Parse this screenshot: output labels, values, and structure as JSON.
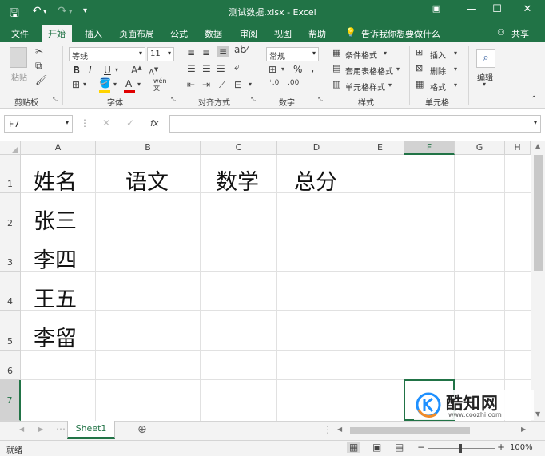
{
  "window": {
    "title": "测试数据.xlsx  -  Excel",
    "controls": [
      "restore-ribbon-icon",
      "minimize-icon",
      "maximize-icon",
      "close-icon"
    ]
  },
  "quick_access": [
    "save-icon",
    "undo-icon",
    "redo-icon",
    "customize-icon"
  ],
  "menu": {
    "tabs": [
      "文件",
      "开始",
      "插入",
      "页面布局",
      "公式",
      "数据",
      "审阅",
      "视图",
      "帮助"
    ],
    "active": "开始",
    "tell_me": "告诉我你想要做什么",
    "share": "共享"
  },
  "ribbon": {
    "clipboard": {
      "paste": "粘贴",
      "group": "剪贴板"
    },
    "font": {
      "name": "等线",
      "size": "11",
      "group": "字体",
      "bold": "B",
      "italic": "I",
      "underline": "U",
      "font_color_letter": "A",
      "wen": "wén\n文"
    },
    "alignment": {
      "group": "对齐方式"
    },
    "number": {
      "format": "常规",
      "percent": "%",
      "comma": ",",
      "group": "数字"
    },
    "styles": {
      "conditional": "条件格式",
      "table": "套用表格格式",
      "cell_styles": "单元格样式",
      "group": "样式"
    },
    "cells": {
      "insert": "插入",
      "delete": "删除",
      "format": "格式",
      "group": "单元格"
    },
    "editing": {
      "label": "编辑"
    }
  },
  "formula_bar": {
    "name_box": "F7",
    "fx": "fx",
    "content": ""
  },
  "columns": [
    "A",
    "B",
    "C",
    "D",
    "E",
    "F",
    "G",
    "H"
  ],
  "rows": [
    "1",
    "2",
    "3",
    "4",
    "5",
    "6",
    "7"
  ],
  "cells": {
    "A1": "姓名",
    "B1": "语文",
    "C1": "数学",
    "D1": "总分",
    "A2": "张三",
    "A3": "李四",
    "A4": "王五",
    "A5": "李留"
  },
  "selected_cell": "F7",
  "sheet_tabs": {
    "active": "Sheet1"
  },
  "status": {
    "ready": "就绪",
    "zoom": "100%"
  },
  "watermark": {
    "brand": "酷知网",
    "url": "www.coozhi.com"
  },
  "colors": {
    "excel_green": "#217346",
    "ribbon_bg": "#f3f3f3",
    "fill_yellow": "#ffd400",
    "font_red": "#e00000"
  }
}
